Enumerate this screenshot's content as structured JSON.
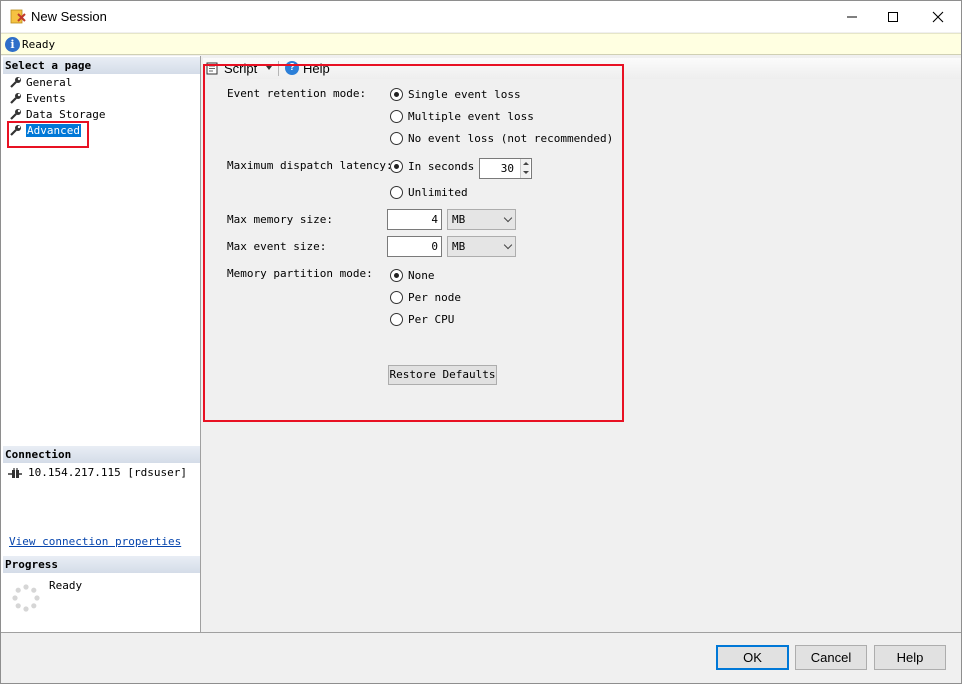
{
  "window": {
    "title": "New Session"
  },
  "status": {
    "text": "Ready"
  },
  "left": {
    "select_page_header": "Select a page",
    "pages": [
      {
        "label": "General",
        "selected": false
      },
      {
        "label": "Events",
        "selected": false
      },
      {
        "label": "Data Storage",
        "selected": false
      },
      {
        "label": "Advanced",
        "selected": true
      }
    ],
    "connection_header": "Connection",
    "connection_text": "10.154.217.115 [rdsuser]",
    "connection_link": "View connection properties",
    "progress_header": "Progress",
    "progress_text": "Ready"
  },
  "toolbar": {
    "script_label": "Script",
    "help_label": "Help"
  },
  "form": {
    "event_retention": {
      "label": "Event retention mode:",
      "options": [
        "Single event loss",
        "Multiple event loss",
        "No event loss (not recommended)"
      ],
      "selected_index": 0
    },
    "dispatch_latency": {
      "label": "Maximum dispatch latency:",
      "option_seconds": "In seconds",
      "seconds_value": "30",
      "option_unlimited": "Unlimited",
      "selected": "seconds"
    },
    "max_memory": {
      "label": "Max memory size:",
      "value": "4",
      "unit": "MB"
    },
    "max_event": {
      "label": "Max event size:",
      "value": "0",
      "unit": "MB"
    },
    "partition_mode": {
      "label": "Memory partition mode:",
      "options": [
        "None",
        "Per node",
        "Per CPU"
      ],
      "selected_index": 0
    },
    "restore_defaults": "Restore Defaults"
  },
  "buttons": {
    "ok": "OK",
    "cancel": "Cancel",
    "help": "Help"
  },
  "colors": {
    "accent": "#0078d7",
    "highlight_box": "#e81123",
    "info_bar": "#ffffe1"
  }
}
